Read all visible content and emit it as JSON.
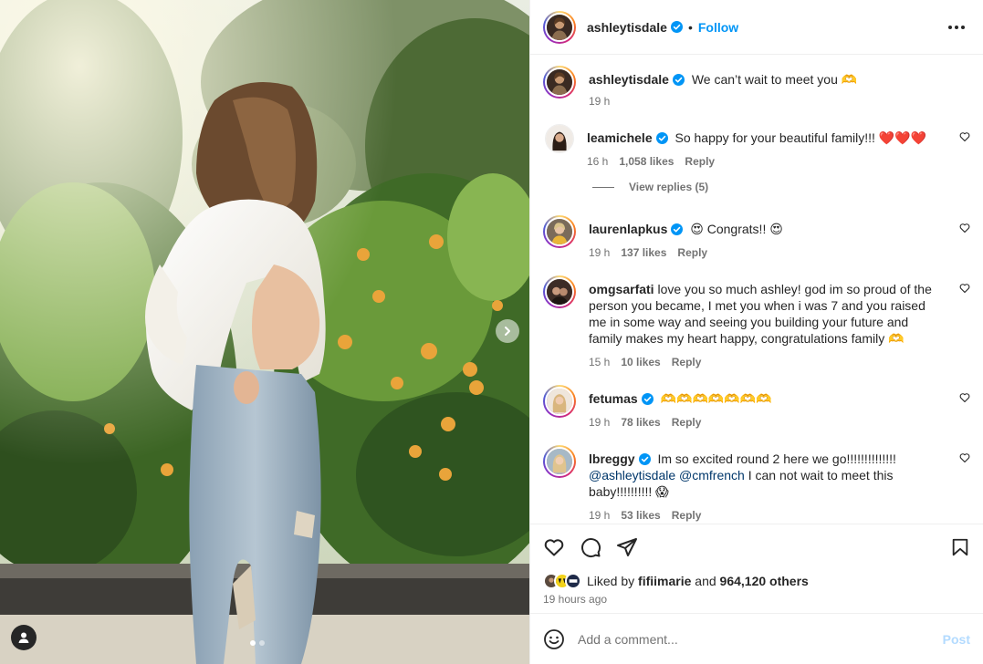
{
  "post": {
    "author": "ashleytisdale",
    "follow_label": "Follow",
    "sep": "•",
    "caption": "We can’t wait to meet you 🫶",
    "caption_time": "19 h"
  },
  "comments": [
    {
      "user": "leamichele",
      "text": "So happy for your beautiful family!!! ❤️❤️❤️",
      "time": "16 h",
      "likes": "1,058 likes",
      "reply": "Reply",
      "view_replies": "View replies (5)"
    },
    {
      "user": "laurenlapkus",
      "text": "😍 Congrats!! 😍",
      "time": "19 h",
      "likes": "137 likes",
      "reply": "Reply"
    },
    {
      "user": "omgsarfati",
      "text": "love you so much ashley! god im so proud of the person you became, I met you when i was 7 and you raised me in some way and seeing you building your future and family makes my heart happy, congratulations family 🫶",
      "time": "15 h",
      "likes": "10 likes",
      "reply": "Reply"
    },
    {
      "user": "fetumas",
      "text": "🫶🫶🫶🫶🫶🫶🫶",
      "time": "19 h",
      "likes": "78 likes",
      "reply": "Reply"
    },
    {
      "user": "lbreggy",
      "text_pre": "Im so excited round 2 here we go!!!!!!!!!!!!!!",
      "mention1": "@ashleytisdale",
      "mention2": "@cmfrench",
      "text_post": " I can not wait to meet this baby!!!!!!!!!! 😱",
      "time": "19 h",
      "likes": "53 likes",
      "reply": "Reply"
    }
  ],
  "likes": {
    "prefix": "Liked by",
    "first_user": "fifiimarie",
    "and": "and",
    "others": "964,120 others",
    "time_ago": "19 hours ago"
  },
  "composer": {
    "placeholder": "Add a comment...",
    "post_label": "Post"
  },
  "colors": {
    "accent": "#0095f6",
    "verified": "#0095f6",
    "heart_red": "#ed4956"
  },
  "icons": [
    "next-arrow-icon",
    "user-tag-icon",
    "more-icon",
    "verified-icon",
    "heart-icon",
    "comment-icon",
    "share-icon",
    "bookmark-icon",
    "emoji-icon"
  ]
}
